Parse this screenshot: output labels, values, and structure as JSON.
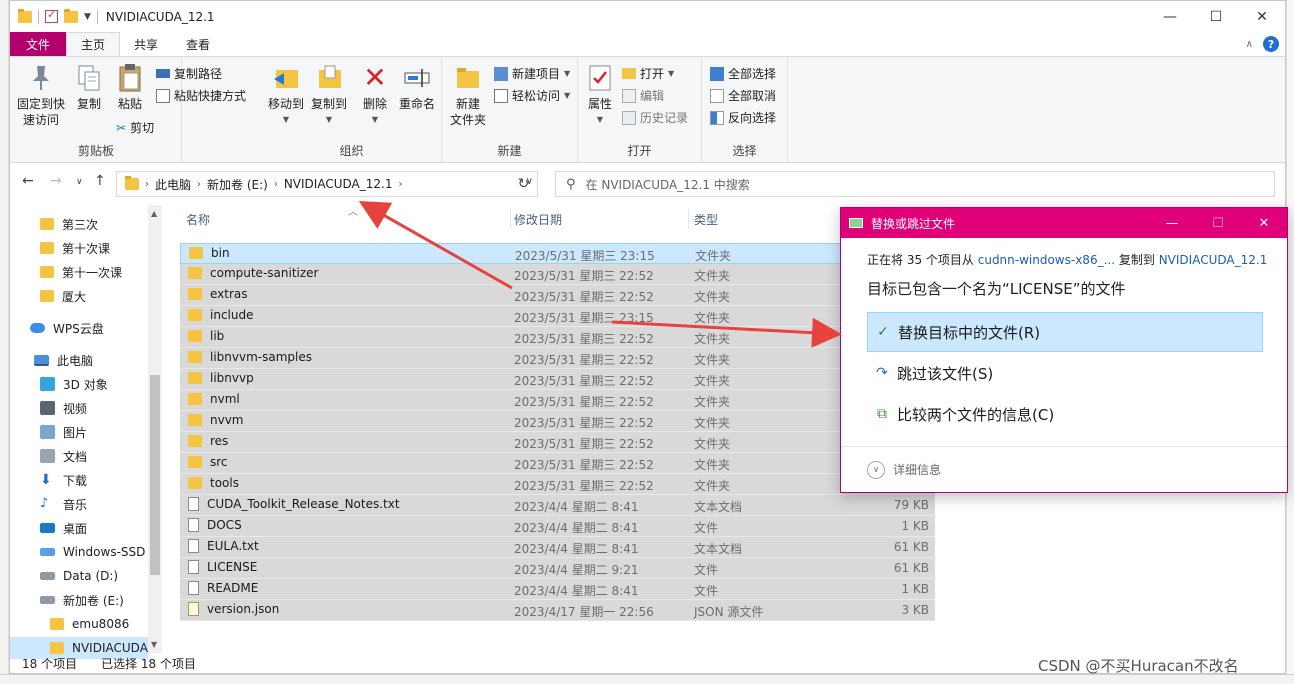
{
  "window": {
    "title": "NVIDIACUDA_12.1",
    "controls": [
      "—",
      "☐",
      "✕"
    ]
  },
  "ribbon_tabs": [
    "文件",
    "主页",
    "共享",
    "查看"
  ],
  "ribbon": {
    "clipboard": {
      "label": "剪贴板",
      "pin": [
        "固定到快",
        "速访问"
      ],
      "copy": "复制",
      "paste": "粘贴",
      "copy_path": "复制路径",
      "paste_shortcut": "粘贴快捷方式",
      "cut": "剪切"
    },
    "organize": {
      "label": "组织",
      "move_to": "移动到",
      "copy_to": "复制到",
      "delete": "删除",
      "rename": "重命名"
    },
    "new": {
      "label": "新建",
      "new_folder": [
        "新建",
        "文件夹"
      ],
      "new_item": "新建项目",
      "easy_access": "轻松访问"
    },
    "open": {
      "label": "打开",
      "properties": "属性",
      "open": "打开",
      "edit": "编辑",
      "history": "历史记录"
    },
    "select": {
      "label": "选择",
      "select_all": "全部选择",
      "select_none": "全部取消",
      "invert": "反向选择"
    }
  },
  "address": {
    "crumbs": [
      "此电脑",
      "新加卷 (E:)",
      "NVIDIACUDA_12.1"
    ],
    "search_placeholder": "在 NVIDIACUDA_12.1 中搜索"
  },
  "nav_pane": {
    "items": [
      {
        "label": "第三次",
        "icon": "folder"
      },
      {
        "label": "第十次课",
        "icon": "folder"
      },
      {
        "label": "第十一次课",
        "icon": "folder"
      },
      {
        "label": "厦大",
        "icon": "folder"
      },
      {
        "label": "WPS云盘",
        "icon": "cloud"
      },
      {
        "label": "此电脑",
        "icon": "pc"
      },
      {
        "label": "3D 对象",
        "icon": "cube"
      },
      {
        "label": "视频",
        "icon": "video"
      },
      {
        "label": "图片",
        "icon": "pic"
      },
      {
        "label": "文档",
        "icon": "doc"
      },
      {
        "label": "下载",
        "icon": "down"
      },
      {
        "label": "音乐",
        "icon": "music"
      },
      {
        "label": "桌面",
        "icon": "desk"
      },
      {
        "label": "Windows-SSD",
        "icon": "winssd"
      },
      {
        "label": "Data (D:)",
        "icon": "drive"
      },
      {
        "label": "新加卷 (E:)",
        "icon": "drive"
      },
      {
        "label": "emu8086",
        "icon": "folder"
      },
      {
        "label": "NVIDIACUDA",
        "icon": "folder"
      }
    ]
  },
  "file_list": {
    "headers": {
      "name": "名称",
      "date": "修改日期",
      "type": "类型"
    },
    "rows": [
      {
        "name": "bin",
        "date": "2023/5/31 星期三 23:15",
        "type": "文件夹",
        "size": "",
        "icon": "folder"
      },
      {
        "name": "compute-sanitizer",
        "date": "2023/5/31 星期三 22:52",
        "type": "文件夹",
        "size": "",
        "icon": "folder"
      },
      {
        "name": "extras",
        "date": "2023/5/31 星期三 22:52",
        "type": "文件夹",
        "size": "",
        "icon": "folder"
      },
      {
        "name": "include",
        "date": "2023/5/31 星期三 23:15",
        "type": "文件夹",
        "size": "",
        "icon": "folder"
      },
      {
        "name": "lib",
        "date": "2023/5/31 星期三 22:52",
        "type": "文件夹",
        "size": "",
        "icon": "folder"
      },
      {
        "name": "libnvvm-samples",
        "date": "2023/5/31 星期三 22:52",
        "type": "文件夹",
        "size": "",
        "icon": "folder"
      },
      {
        "name": "libnvvp",
        "date": "2023/5/31 星期三 22:52",
        "type": "文件夹",
        "size": "",
        "icon": "folder"
      },
      {
        "name": "nvml",
        "date": "2023/5/31 星期三 22:52",
        "type": "文件夹",
        "size": "",
        "icon": "folder"
      },
      {
        "name": "nvvm",
        "date": "2023/5/31 星期三 22:52",
        "type": "文件夹",
        "size": "",
        "icon": "folder"
      },
      {
        "name": "res",
        "date": "2023/5/31 星期三 22:52",
        "type": "文件夹",
        "size": "",
        "icon": "folder"
      },
      {
        "name": "src",
        "date": "2023/5/31 星期三 22:52",
        "type": "文件夹",
        "size": "",
        "icon": "folder"
      },
      {
        "name": "tools",
        "date": "2023/5/31 星期三 22:52",
        "type": "文件夹",
        "size": "",
        "icon": "folder"
      },
      {
        "name": "CUDA_Toolkit_Release_Notes.txt",
        "date": "2023/4/4 星期二 8:41",
        "type": "文本文档",
        "size": "79 KB",
        "icon": "txt"
      },
      {
        "name": "DOCS",
        "date": "2023/4/4 星期二 8:41",
        "type": "文件",
        "size": "1 KB",
        "icon": "txt"
      },
      {
        "name": "EULA.txt",
        "date": "2023/4/4 星期二 8:41",
        "type": "文本文档",
        "size": "61 KB",
        "icon": "txt"
      },
      {
        "name": "LICENSE",
        "date": "2023/4/4 星期二 9:21",
        "type": "文件",
        "size": "61 KB",
        "icon": "txt"
      },
      {
        "name": "README",
        "date": "2023/4/4 星期二 8:41",
        "type": "文件",
        "size": "1 KB",
        "icon": "txt"
      },
      {
        "name": "version.json",
        "date": "2023/4/17 星期一 22:56",
        "type": "JSON 源文件",
        "size": "3 KB",
        "icon": "json"
      }
    ]
  },
  "status": {
    "count": "18 个项目",
    "selected": "已选择 18 个项目"
  },
  "dialog": {
    "title": "替换或跳过文件",
    "line1_a": "正在将 35 个项目从",
    "line1_src": "cudnn-windows-x86_...",
    "line1_b": "复制到",
    "line1_dst": "NVIDIACUDA_12.1",
    "line2": "目标已包含一个名为“LICENSE”的文件",
    "opt_replace": "替换目标中的文件(R)",
    "opt_skip": "跳过该文件(S)",
    "opt_compare": "比较两个文件的信息(C)",
    "details": "详细信息"
  },
  "watermark": "CSDN @不买Huracan不改名",
  "colors": {
    "file_tab": "#b4006e",
    "dialog_title": "#e0007a",
    "selection": "#cce8ff",
    "arrow": "#e8423f"
  }
}
